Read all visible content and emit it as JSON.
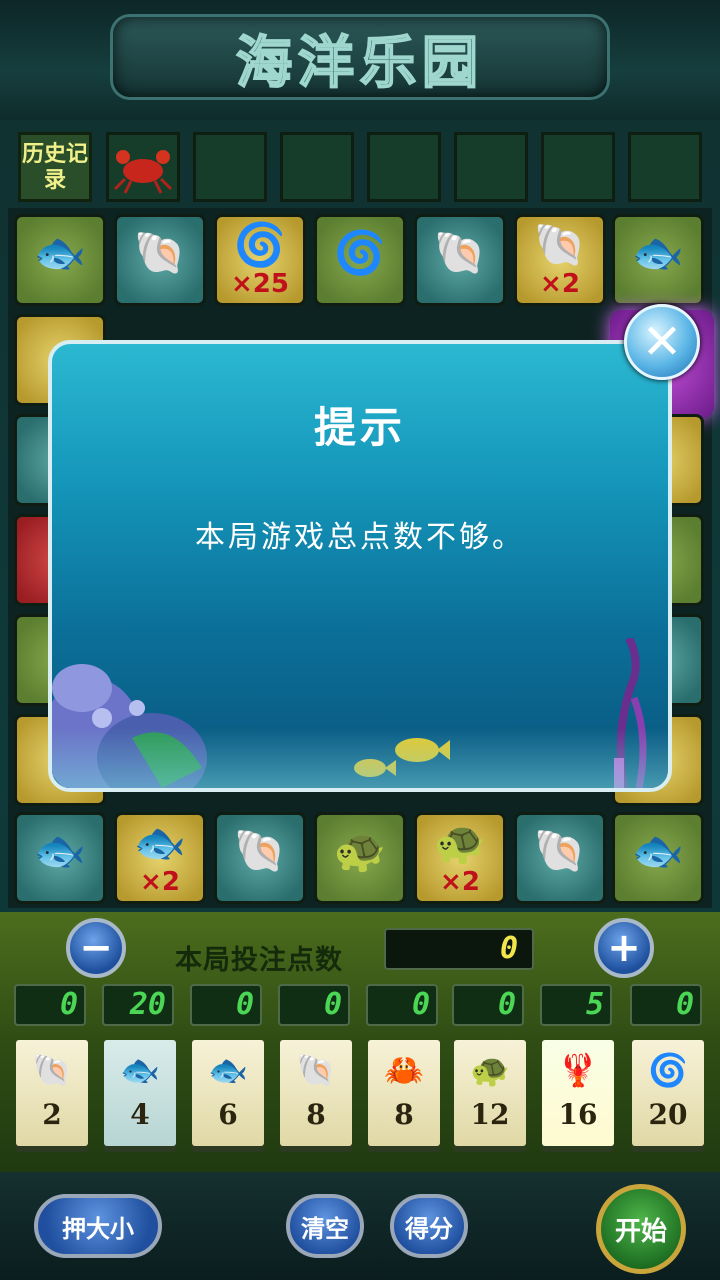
{
  "header": {
    "title": "海洋乐园"
  },
  "history": {
    "label": "历史记录",
    "slots": [
      "crab",
      "",
      "",
      "",
      "",
      "",
      ""
    ]
  },
  "board": {
    "top_row": [
      {
        "icon": "pomfret",
        "mult": ""
      },
      {
        "icon": "nautilus",
        "mult": ""
      },
      {
        "icon": "seahorse",
        "mult": "×25"
      },
      {
        "icon": "seahorse",
        "mult": ""
      },
      {
        "icon": "scallop",
        "mult": ""
      },
      {
        "icon": "scallop",
        "mult": "×2"
      },
      {
        "icon": "mackerel",
        "mult": ""
      }
    ],
    "bottom_row": [
      {
        "icon": "mackerel",
        "mult": ""
      },
      {
        "icon": "mackerel",
        "mult": "×2"
      },
      {
        "icon": "scallop",
        "mult": ""
      },
      {
        "icon": "turtle",
        "mult": ""
      },
      {
        "icon": "turtle",
        "mult": "×2"
      },
      {
        "icon": "nautilus",
        "mult": ""
      },
      {
        "icon": "pomfret",
        "mult": ""
      }
    ]
  },
  "dialog": {
    "title": "提示",
    "message": "本局游戏总点数不够。"
  },
  "bet": {
    "label": "本局投注点数",
    "total": "0",
    "minus": "−",
    "plus": "+",
    "slots": [
      "0",
      "20",
      "0",
      "0",
      "0",
      "0",
      "5",
      "0"
    ]
  },
  "cards": [
    {
      "icon": "scallop",
      "odds": "2"
    },
    {
      "icon": "pomfret",
      "odds": "4"
    },
    {
      "icon": "mackerel",
      "odds": "6"
    },
    {
      "icon": "nautilus",
      "odds": "8"
    },
    {
      "icon": "crab",
      "odds": "8"
    },
    {
      "icon": "turtle",
      "odds": "12"
    },
    {
      "icon": "lobster",
      "odds": "16"
    },
    {
      "icon": "seahorse",
      "odds": "20"
    }
  ],
  "controls": {
    "bet_size": "押大小",
    "clear": "清空",
    "score": "得分",
    "start": "开始"
  }
}
